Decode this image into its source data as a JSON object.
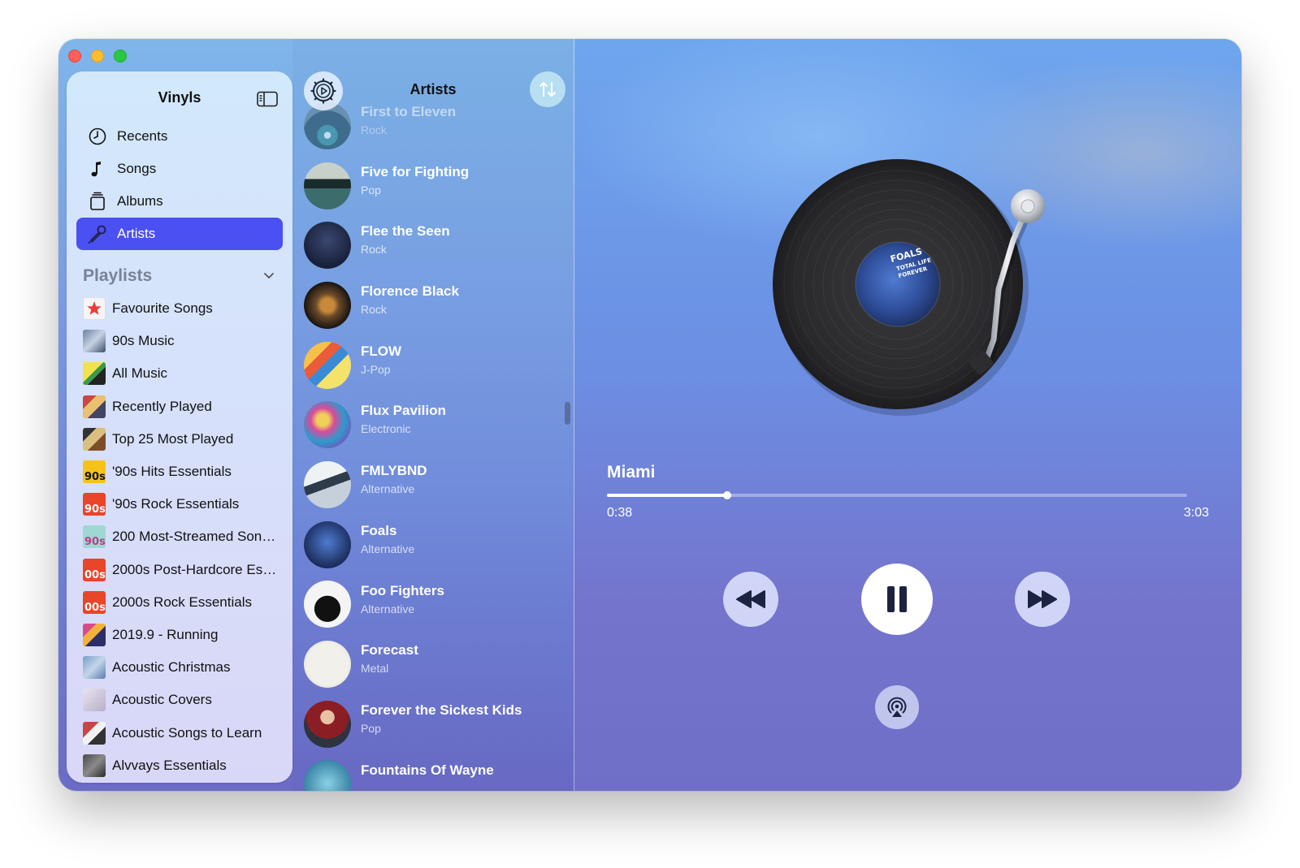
{
  "window": {
    "title": "Vinyls"
  },
  "sidebar": {
    "title": "Vinyls",
    "toggle_icon": "sidebar-toggle-icon",
    "nav": [
      {
        "label": "Recents",
        "icon": "clock-icon"
      },
      {
        "label": "Songs",
        "icon": "music-note-icon"
      },
      {
        "label": "Albums",
        "icon": "album-stack-icon"
      },
      {
        "label": "Artists",
        "icon": "microphone-icon",
        "active": true
      }
    ],
    "playlists_header": "Playlists",
    "playlists": [
      {
        "label": "Favourite Songs"
      },
      {
        "label": "90s Music"
      },
      {
        "label": "All Music"
      },
      {
        "label": "Recently Played"
      },
      {
        "label": "Top 25 Most Played"
      },
      {
        "label": "'90s Hits Essentials"
      },
      {
        "label": "'90s Rock Essentials"
      },
      {
        "label": "200 Most-Streamed Song..."
      },
      {
        "label": "2000s Post-Hardcore Ess..."
      },
      {
        "label": "2000s Rock Essentials"
      },
      {
        "label": "2019.9 - Running"
      },
      {
        "label": "Acoustic Christmas"
      },
      {
        "label": "Acoustic Covers"
      },
      {
        "label": "Acoustic Songs to Learn"
      },
      {
        "label": "Alvvays Essentials"
      }
    ]
  },
  "artists_panel": {
    "title": "Artists",
    "artists": [
      {
        "name": "First to Eleven",
        "genre": "Rock"
      },
      {
        "name": "Five for Fighting",
        "genre": "Pop"
      },
      {
        "name": "Flee the Seen",
        "genre": "Rock"
      },
      {
        "name": "Florence Black",
        "genre": "Rock"
      },
      {
        "name": "FLOW",
        "genre": "J-Pop"
      },
      {
        "name": "Flux Pavilion",
        "genre": "Electronic"
      },
      {
        "name": "FMLYBND",
        "genre": "Alternative"
      },
      {
        "name": "Foals",
        "genre": "Alternative"
      },
      {
        "name": "Foo Fighters",
        "genre": "Alternative"
      },
      {
        "name": "Forecast",
        "genre": "Metal"
      },
      {
        "name": "Forever the Sickest Kids",
        "genre": "Pop"
      },
      {
        "name": "Fountains Of Wayne",
        "genre": ""
      }
    ]
  },
  "player": {
    "song_title": "Miami",
    "current_time": "0:38",
    "total_time": "3:03",
    "progress": 0.207,
    "record_label_text": "FOALS TOTAL LIFE FOREVER",
    "controls": {
      "rewind_icon": "rewind-icon",
      "pause_icon": "pause-icon",
      "forward_icon": "fast-forward-icon",
      "airplay_icon": "airplay-icon"
    }
  }
}
